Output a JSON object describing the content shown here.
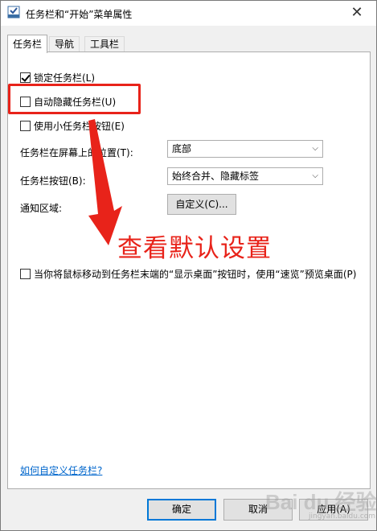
{
  "window": {
    "title": "任务栏和“开始”菜单属性",
    "close_glyph": "✕"
  },
  "tabs": [
    {
      "label": "任务栏",
      "active": true
    },
    {
      "label": "导航",
      "active": false
    },
    {
      "label": "工具栏",
      "active": false
    }
  ],
  "options": {
    "lock_taskbar": {
      "label": "锁定任务栏(L)",
      "checked": true
    },
    "auto_hide": {
      "label": "自动隐藏任务栏(U)",
      "checked": false
    },
    "small_buttons": {
      "label": "使用小任务栏按钮(E)",
      "checked": false
    },
    "peek": {
      "label": "当你将鼠标移动到任务栏末端的“显示桌面”按钮时，使用“速览”预览桌面(P)",
      "checked": false
    }
  },
  "location": {
    "label": "任务栏在屏幕上的位置(T):",
    "value": "底部"
  },
  "buttons_setting": {
    "label": "任务栏按钮(B):",
    "value": "始终合并、隐藏标签"
  },
  "notification": {
    "label": "通知区域:",
    "button": "自定义(C)..."
  },
  "help_link": "如何自定义任务栏?",
  "footer": {
    "ok": "确定",
    "cancel": "取消",
    "apply": "应用(A)"
  },
  "annotation": {
    "text": "查看默认设置",
    "color": "#e8231a"
  },
  "watermark": {
    "text": "Bai du 经验",
    "sub": "jingyan.baidu.com"
  }
}
